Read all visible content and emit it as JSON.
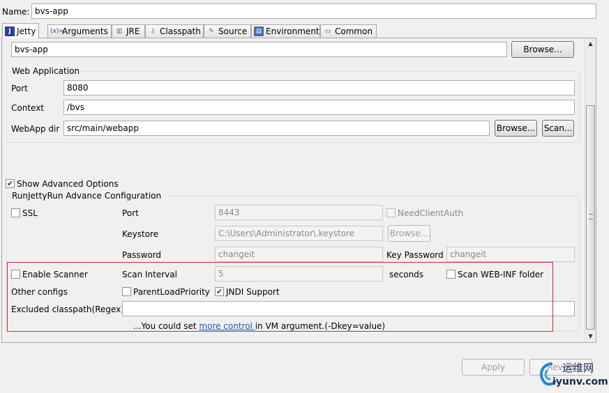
{
  "name": {
    "label": "Name:",
    "value": "bvs-app"
  },
  "tabs": [
    {
      "label": "Jetty",
      "icon": "jetty-icon",
      "active": true
    },
    {
      "label": "Arguments",
      "icon": "arguments-icon"
    },
    {
      "label": "JRE",
      "icon": "jre-icon"
    },
    {
      "label": "Classpath",
      "icon": "classpath-icon"
    },
    {
      "label": "Source",
      "icon": "source-icon"
    },
    {
      "label": "Environment",
      "icon": "environment-icon"
    },
    {
      "label": "Common",
      "icon": "common-icon"
    }
  ],
  "project": {
    "value": "bvs-app",
    "browse_label": "Browse..."
  },
  "web_app": {
    "title": "Web Application",
    "port_label": "Port",
    "port_value": "8080",
    "context_label": "Context",
    "context_value": "/bvs",
    "webapp_dir_label": "WebApp dir",
    "webapp_dir_value": "src/main/webapp",
    "browse_label": "Browse...",
    "scan_label": "Scan..."
  },
  "show_advanced": {
    "label": "Show Advanced Options",
    "checked": true
  },
  "advanced": {
    "title": "RunJettyRun Advance Configuration",
    "ssl_label": "SSL",
    "port_label": "Port",
    "port_value": "8443",
    "need_client_auth_label": "NeedClientAuth",
    "keystore_label": "Keystore",
    "keystore_value": "C:\\Users\\Administrator\\.keystore",
    "keystore_browse_label": "Browse...",
    "password_label": "Password",
    "password_value": "changeit",
    "key_password_label": "Key Password",
    "key_password_value": "changeit",
    "enable_scanner_label": "Enable Scanner",
    "scan_interval_label": "Scan Interval",
    "scan_interval_value": "5",
    "seconds_label": "seconds",
    "scan_webinf_label": "Scan WEB-INF folder",
    "other_configs_label": "Other configs",
    "parent_load_priority_label": "ParentLoadPriority",
    "jndi_support_label": "JNDI Support",
    "excluded_classpath_label": "Excluded classpath(Regex)",
    "excluded_classpath_value": "",
    "hint_prefix": "...You could set ",
    "hint_link": "more control ",
    "hint_suffix": " in VM argument.(-Dkey=value)"
  },
  "footer": {
    "apply_label": "Apply",
    "revert_label": "Revert"
  },
  "watermark": {
    "text1": "运维网",
    "text2": "iyunv.com"
  },
  "colors": {
    "highlight_box": "#d32a2a",
    "link": "#1f5fbf"
  }
}
